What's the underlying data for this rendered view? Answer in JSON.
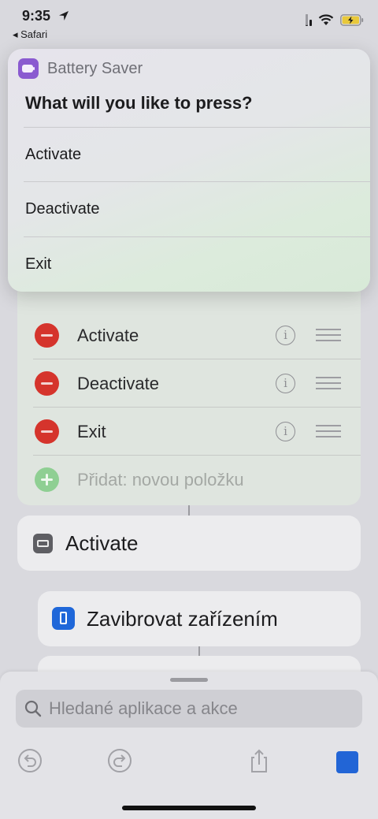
{
  "status_bar": {
    "time": "9:35",
    "back_app": "Safari",
    "icons": [
      "location-arrow-icon",
      "cellular-signal-icon",
      "wifi-icon",
      "battery-charging-icon"
    ]
  },
  "popup": {
    "app_name": "Battery Saver",
    "prompt": "What will you like to press?",
    "options": [
      "Activate",
      "Deactivate",
      "Exit"
    ],
    "app_icon_color": "#8a5ad0"
  },
  "editor": {
    "list_items": [
      "Activate",
      "Deactivate",
      "Exit"
    ],
    "add_item_placeholder": "Přidat: novou položku",
    "actions": {
      "activate": "Activate",
      "vibrate": "Zavibrovat zařízením"
    },
    "colors": {
      "remove": "#d5342c",
      "add": "#8fcf93",
      "vibrate_icon": "#1f67d9"
    }
  },
  "bottom_sheet": {
    "search_placeholder": "Hledané aplikace a akce",
    "toolbar": [
      "undo-icon",
      "redo-icon",
      "share-icon",
      "stop-icon"
    ],
    "stop_color": "#2265d6"
  }
}
